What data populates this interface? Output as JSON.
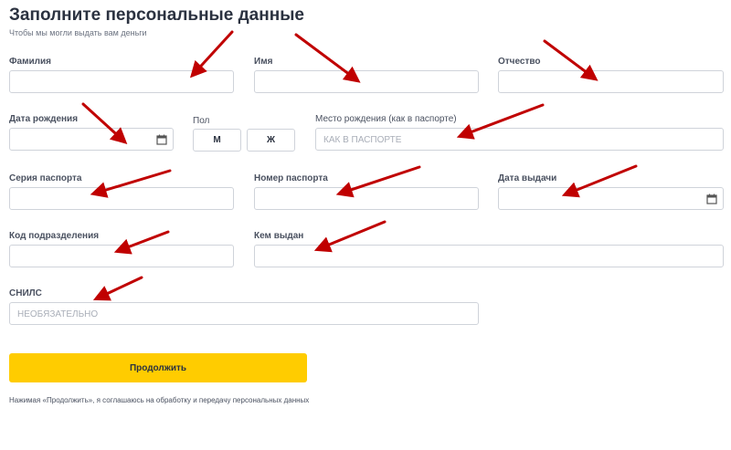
{
  "header": {
    "title": "Заполните персональные данные",
    "subtitle": "Чтобы мы могли выдать вам деньги"
  },
  "fields": {
    "last_name": {
      "label": "Фамилия",
      "value": ""
    },
    "first_name": {
      "label": "Имя",
      "value": ""
    },
    "patronymic": {
      "label": "Отчество",
      "value": ""
    },
    "birth_date": {
      "label": "Дата рождения",
      "value": "",
      "icon": "calendar-icon"
    },
    "sex": {
      "label": "Пол",
      "options": [
        "М",
        "Ж"
      ]
    },
    "birth_place": {
      "label": "Место рождения (как в паспорте)",
      "placeholder": "КАК В ПАСПОРТЕ"
    },
    "passport_series": {
      "label": "Серия паспорта",
      "value": ""
    },
    "passport_number": {
      "label": "Номер паспорта",
      "value": ""
    },
    "issue_date": {
      "label": "Дата выдачи",
      "value": "",
      "icon": "calendar-icon"
    },
    "division_code": {
      "label": "Код подразделения",
      "value": ""
    },
    "issued_by": {
      "label": "Кем выдан",
      "value": ""
    },
    "snils": {
      "label": "СНИЛС",
      "placeholder": "НЕОБЯЗАТЕЛЬНО"
    }
  },
  "actions": {
    "continue_label": "Продолжить"
  },
  "footer": {
    "consent": "Нажимая «Продолжить», я соглашаюсь на обработку и передачу персональных данных"
  },
  "colors": {
    "accent": "#ffcc00",
    "annotation_arrow": "#c00000",
    "border": "#cfd3da",
    "text": "#2b3240"
  }
}
